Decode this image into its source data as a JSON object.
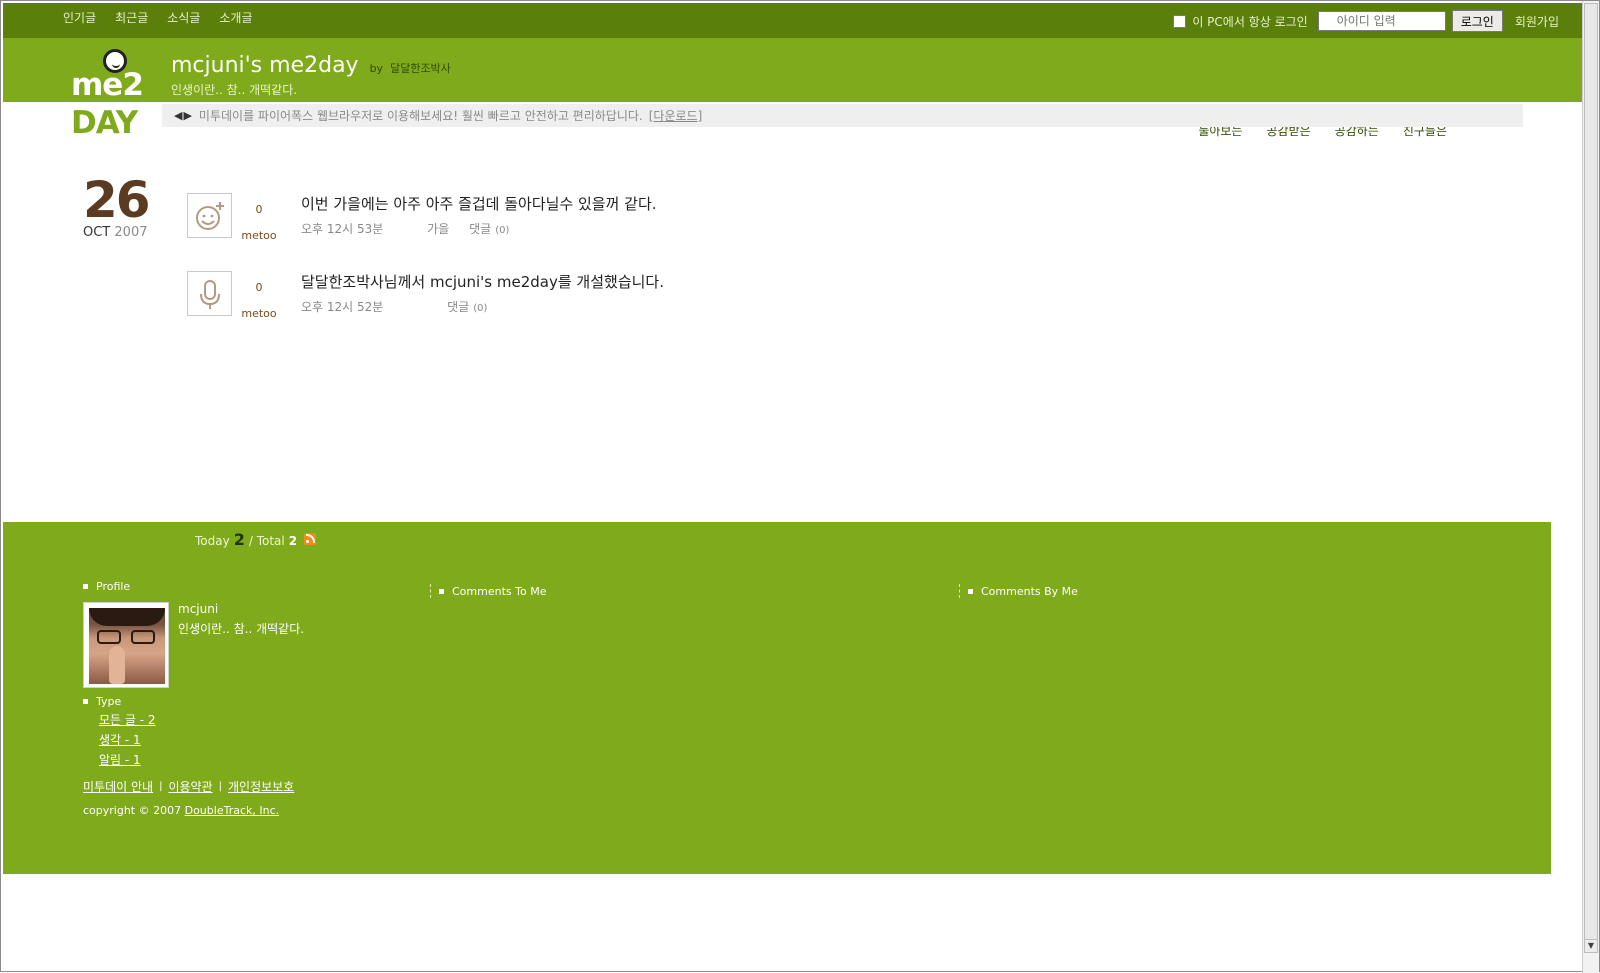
{
  "topnav": {
    "items": [
      "인기글",
      "최근글",
      "소식글",
      "소개글"
    ]
  },
  "login": {
    "remember_label": "이 PC에서 항상 로그인",
    "id_placeholder": "아이디 입력",
    "login_button": "로그인",
    "join_link": "회원가입"
  },
  "header": {
    "logo_top": "me2",
    "logo_bottom": "DAY",
    "title": "mcjuni's me2day",
    "by_label": "by",
    "by_name": "달달한조박사",
    "tagline": "인생이란.. 참.. 개떡같다.",
    "nav": [
      "둘아보는",
      "공감받은",
      "공감하는",
      "친구들은"
    ]
  },
  "notice": {
    "arrows": "◀▶",
    "message": "미투데이를 파이어폭스 웹브라우저로 이용해보세요! 훨씬 빠르고 안전하고 편리하답니다.",
    "download": "[다운로드]"
  },
  "date": {
    "day": "26",
    "month": "OCT",
    "year": "2007"
  },
  "posts": [
    {
      "icon": "smile-plus-icon",
      "count": "0",
      "metoo": "metoo",
      "text": "이번 가을에는 아주 아주 즐겁데 돌아다닐수 있을꺼 같다.",
      "time": "오후 12시 53분",
      "tag": "가을",
      "comments": "댓글",
      "comment_count": "(0)"
    },
    {
      "icon": "microphone-icon",
      "count": "0",
      "metoo": "metoo",
      "text": "달달한조박사님께서 mcjuni's me2day를 개설했습니다.",
      "time": "오후 12시 52분",
      "tag": "",
      "comments": "댓글",
      "comment_count": "(0)"
    }
  ],
  "footer": {
    "today_label": "Today",
    "today_count": "2",
    "total_label": "/ Total",
    "total_count": "2",
    "profile_heading": "Profile",
    "profile_name": "mcjuni",
    "profile_message": "인생이란.. 참.. 개떡같다.",
    "comments_to_me": "Comments To Me",
    "comments_by_me": "Comments By Me",
    "type_heading": "Type",
    "types": [
      "모든 글 - 2",
      "생각 - 1",
      "알림 - 1"
    ],
    "links": [
      "미투데이 안내",
      "이용약관",
      "개인정보보호"
    ],
    "link_separator": "|",
    "copyright": "copyright © 2007",
    "company": "DoubleTrack, Inc."
  },
  "colors": {
    "top_bar": "#5b7f0b",
    "brand_green": "#7faa1b",
    "date_brown": "#5b3b22"
  }
}
